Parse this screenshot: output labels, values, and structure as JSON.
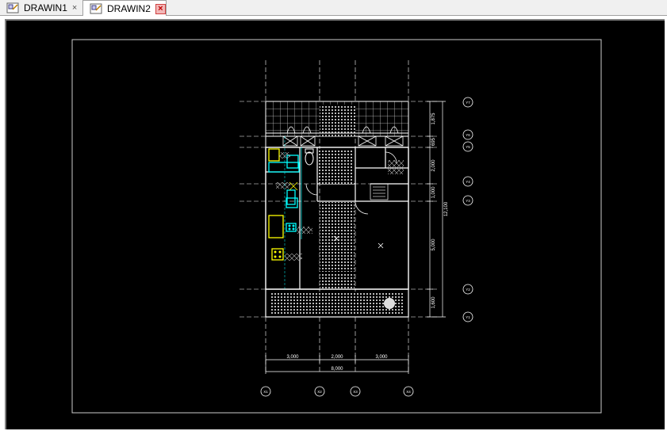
{
  "tabs": [
    {
      "label": "DRAWIN1",
      "close": "×",
      "active": false
    },
    {
      "label": "DRAWIN2",
      "close": "×",
      "active": true
    }
  ],
  "colors": {
    "viewport_bg": "#000000",
    "line": "#ffffff",
    "cyan": "#00ffff",
    "yellow": "#ffff00"
  },
  "drawing": {
    "grid_bubbles_right": [
      "Y7",
      "Y6",
      "Y5",
      "Y4",
      "Y3",
      "Y2",
      "Y1"
    ],
    "grid_bubbles_bottom": [
      "X1",
      "X2",
      "X3",
      "X4"
    ],
    "dims_right": [
      "1,875",
      "695",
      "2,000",
      "1,000",
      "5,000",
      "1,600"
    ],
    "dim_total_right": "12,100",
    "dims_bottom": [
      "3,000",
      "2,000",
      "3,000"
    ],
    "dim_total_bottom": "8,000"
  }
}
